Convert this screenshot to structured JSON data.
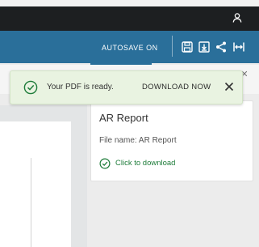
{
  "colors": {
    "top_bar": "#1d1f21",
    "toolbar": "#2a6f9a",
    "toast_bg": "#e9f3e1",
    "success_green": "#1e7c3a"
  },
  "top_bar": {
    "user_icon": "user-icon"
  },
  "toolbar": {
    "autosave_label": "AUTOSAVE ON",
    "icons": [
      "save-icon",
      "export-icon",
      "share-icon",
      "fit-width-icon"
    ]
  },
  "toast": {
    "icon": "check-circle-icon",
    "message": "Your PDF is ready.",
    "action": "DOWNLOAD NOW",
    "close_icon": "close-icon"
  },
  "side_panel": {
    "close_icon": "close-icon",
    "card": {
      "title": "AR Report",
      "file_name": "File name: AR Report",
      "download_icon": "check-circle-icon",
      "download_link": "Click to download"
    }
  }
}
